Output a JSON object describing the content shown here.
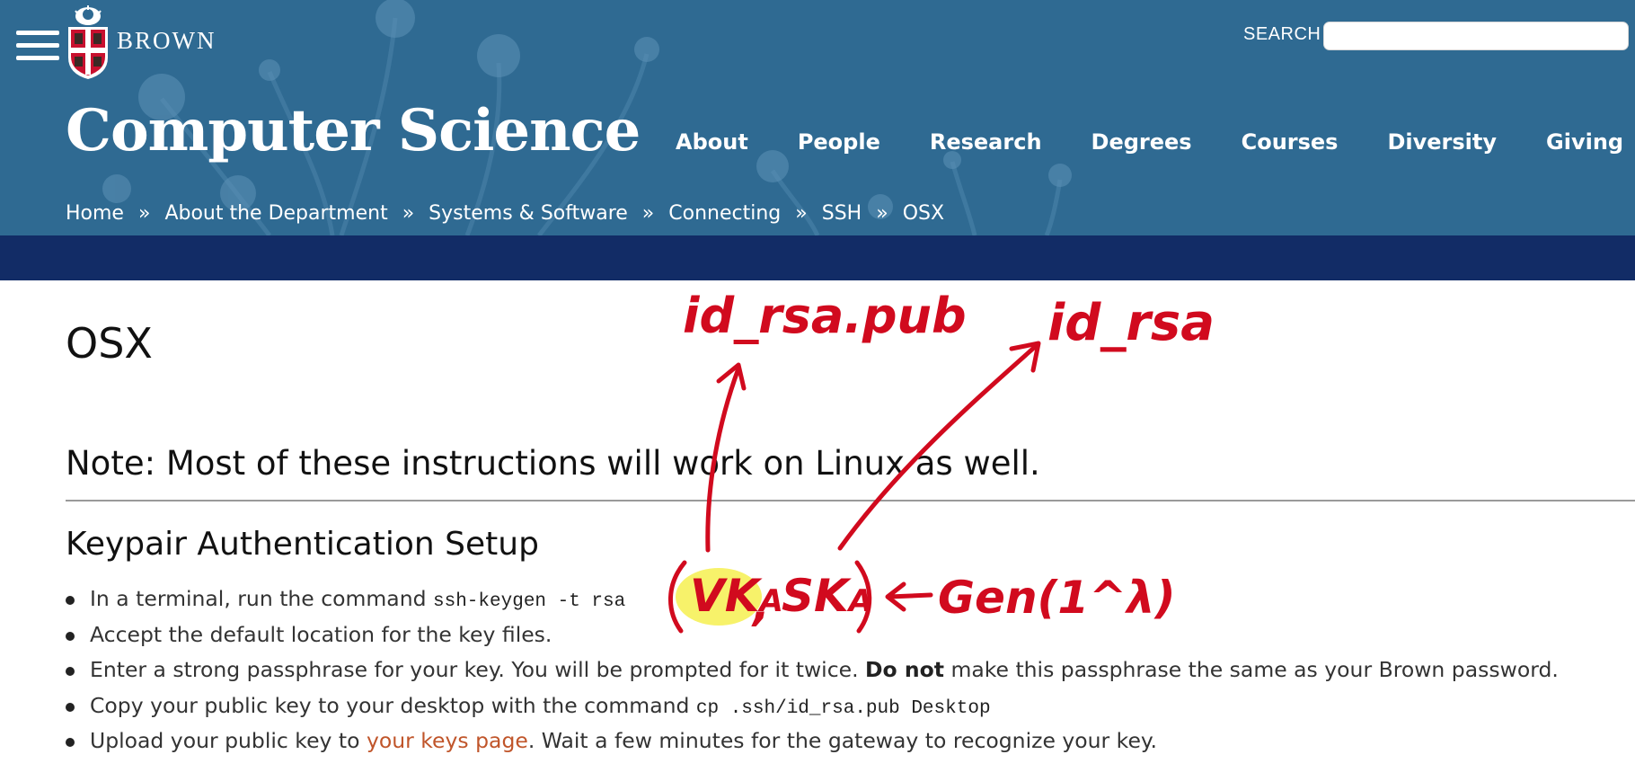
{
  "header": {
    "wordmark": "BROWN",
    "site_title": "Computer Science",
    "search": {
      "label": "SEARCH",
      "value": "",
      "placeholder": ""
    },
    "nav": [
      "About",
      "People",
      "Research",
      "Degrees",
      "Courses",
      "Diversity",
      "Giving"
    ],
    "breadcrumb": [
      "Home",
      "About the Department",
      "Systems & Software",
      "Connecting",
      "SSH",
      "OSX"
    ],
    "breadcrumb_separator": "»"
  },
  "main": {
    "page_title": "OSX",
    "note": "Note: Most of these instructions will work on Linux as well.",
    "section_heading": "Keypair Authentication Setup",
    "steps": [
      {
        "text": "In a terminal, run the command ",
        "code": "ssh-keygen -t rsa"
      },
      {
        "text": "Accept the default location for the key files."
      },
      {
        "pre": "Enter a strong passphrase for your key. You will be prompted for it twice. ",
        "bold": "Do not",
        "post": " make this passphrase the same as your Brown password."
      },
      {
        "text": "Copy your public key to your desktop with the command ",
        "code": "cp .ssh/id_rsa.pub Desktop"
      },
      {
        "pre": "Upload your public key to ",
        "link": "your keys page",
        "post": ". Wait a few minutes for the gateway to recognize your key."
      }
    ]
  },
  "annotations": {
    "label_pub": "id_rsa.pub",
    "label_priv": "id_rsa",
    "vk": "VK",
    "sk": "SK",
    "subscript": "A",
    "gen": "Gen(1^λ)",
    "ink_color": "#d10a1e",
    "highlight_color": "#f7f26a"
  },
  "colors": {
    "header_bg": "#2f6a92",
    "band_bg": "#122c66",
    "link": "#c0552a"
  },
  "icons": [
    "hamburger-menu-icon",
    "brown-shield-logo"
  ]
}
